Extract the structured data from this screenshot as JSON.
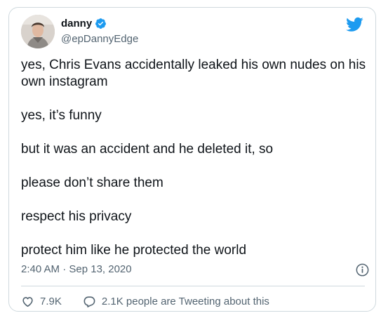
{
  "tweet": {
    "author_name": "danny",
    "author_handle": "@epDannyEdge",
    "paragraphs": [
      "yes, Chris Evans accidentally leaked his own nudes on his own instagram",
      "yes, it’s funny",
      "but it was an accident and he deleted it, so",
      "please don’t share them",
      "respect his privacy",
      "protect him like he protected the world"
    ],
    "timestamp": "2:40 AM · Sep 13, 2020",
    "likes": "7.9K",
    "tweeting_about": "2.1K people are Tweeting about this"
  },
  "colors": {
    "twitter_blue": "#1d9bf0",
    "text_primary": "#0f1419",
    "text_secondary": "#536471",
    "border": "#cfd9de"
  },
  "icons": [
    "verified-badge-icon",
    "twitter-bird-icon",
    "info-icon",
    "heart-icon",
    "reply-bubble-icon"
  ]
}
